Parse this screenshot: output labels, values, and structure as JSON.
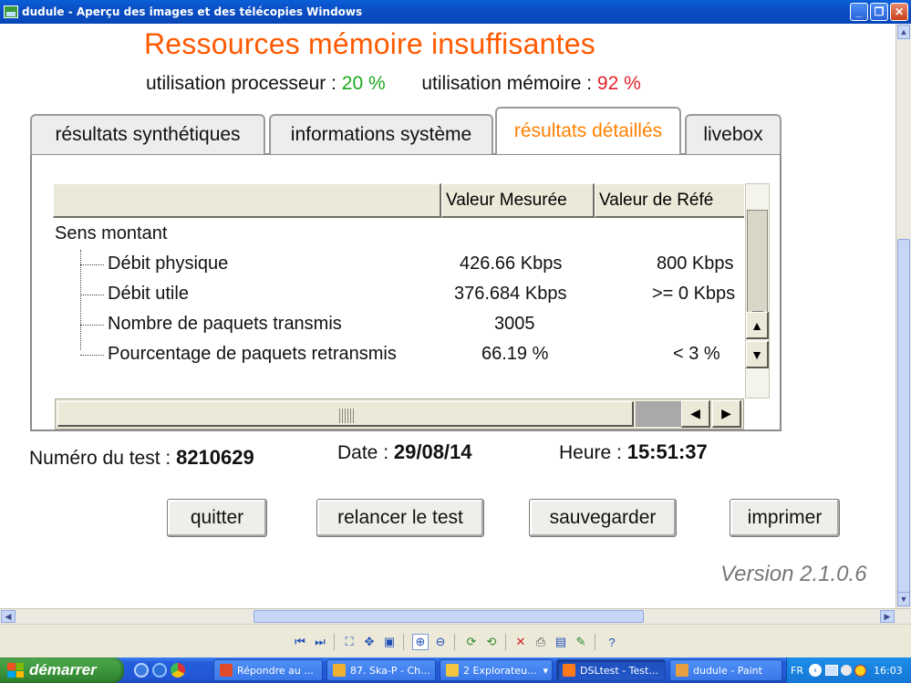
{
  "window": {
    "title": "dudule - Aperçu des images et des télécopies Windows",
    "minimize": "_",
    "maximize": "❐",
    "close": "✕"
  },
  "app": {
    "warning_title": "Ressources mémoire insuffisantes",
    "cpu_label": "utilisation processeur : ",
    "cpu_value": "20 %",
    "mem_label": "utilisation mémoire : ",
    "mem_value": "92 %",
    "tabs": [
      {
        "label": "résultats synthétiques",
        "active": false
      },
      {
        "label": "informations système",
        "active": false
      },
      {
        "label": "résultats détaillés",
        "active": true
      },
      {
        "label": "livebox",
        "active": false
      }
    ],
    "grid": {
      "headers": [
        "",
        "Valeur Mesurée",
        "Valeur de Réfé"
      ],
      "group": "Sens montant",
      "rows": [
        {
          "name": "Débit physique",
          "measured": "426.66 Kbps",
          "reference": "800 Kbps"
        },
        {
          "name": "Débit utile",
          "measured": "376.684 Kbps",
          "reference": ">= 0 Kbps"
        },
        {
          "name": "Nombre de paquets transmis",
          "measured": "3005",
          "reference": ""
        },
        {
          "name": "Pourcentage de paquets retransmis",
          "measured": "66.19 %",
          "reference": "< 3 %"
        }
      ]
    },
    "test_number_label": "Numéro du test : ",
    "test_number": "8210629",
    "date_label": "Date : ",
    "date": "29/08/14",
    "time_label": "Heure : ",
    "time": "15:51:37",
    "buttons": {
      "quit": "quitter",
      "rerun": "relancer le test",
      "save": "sauvegarder",
      "print": "imprimer"
    },
    "version": "Version 2.1.0.6"
  },
  "taskbar": {
    "start": "démarrer",
    "tasks": [
      {
        "label": "Répondre au ...",
        "color": "#e04a2a"
      },
      {
        "label": "87. Ska-P - Ch...",
        "color": "#f0b030"
      },
      {
        "label": "2 Explorateu...",
        "color": "#f2c640"
      },
      {
        "label": "DSLtest - Test...",
        "color": "#ff7a1a"
      },
      {
        "label": "dudule - Paint",
        "color": "#e8a040"
      }
    ],
    "language": "FR",
    "clock": "16:03"
  }
}
